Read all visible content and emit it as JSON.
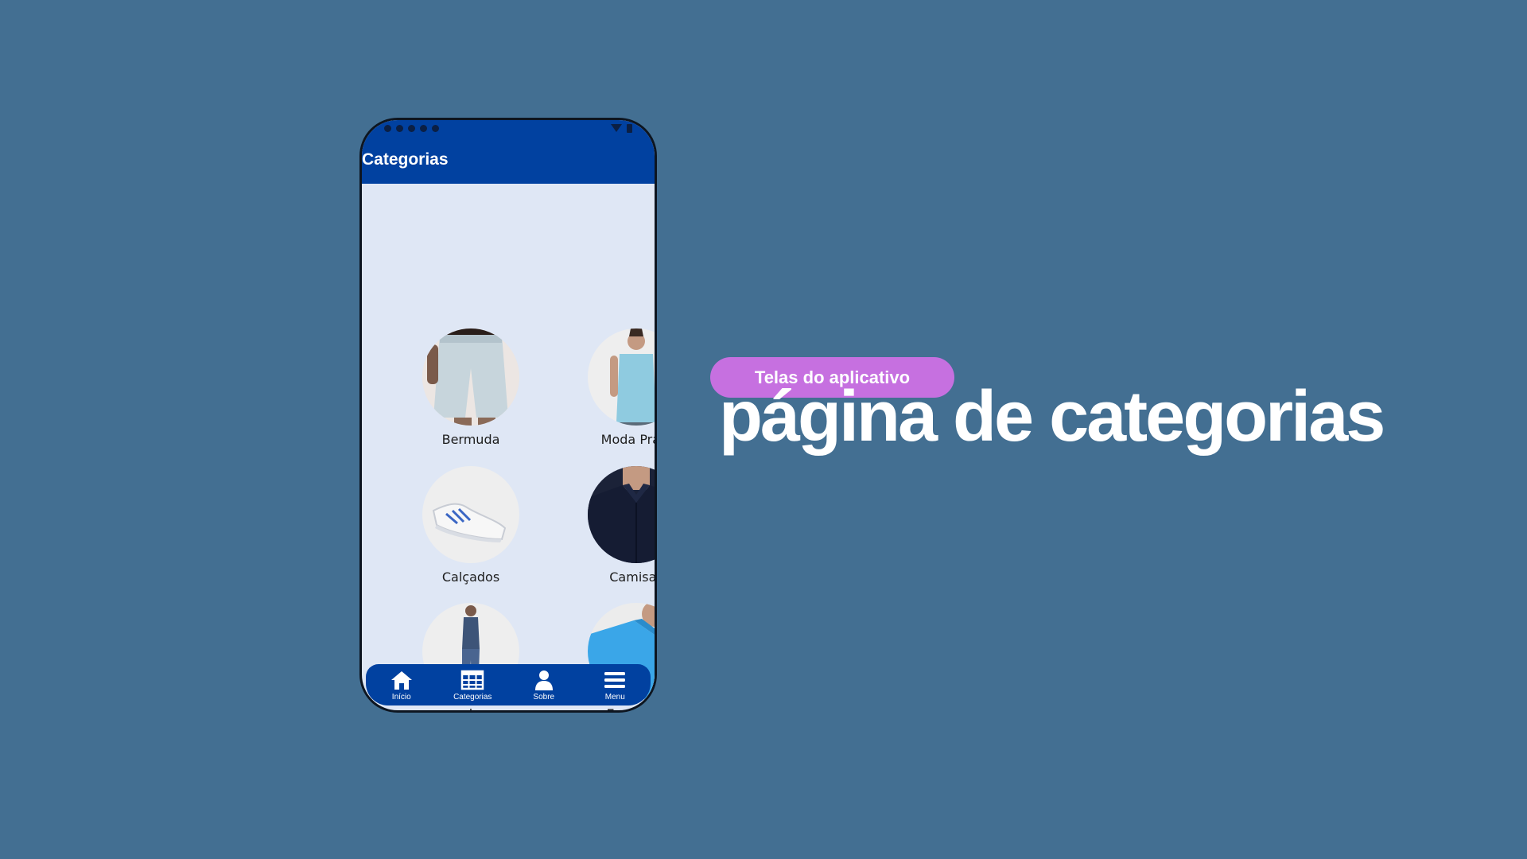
{
  "app": {
    "title": "Categorias"
  },
  "categories": [
    {
      "label": "Bermuda",
      "icon": "shorts-photo"
    },
    {
      "label": "Moda Praia",
      "icon": "tank-top-photo"
    },
    {
      "label": "Calçados",
      "icon": "sneaker-photo"
    },
    {
      "label": "Camisas",
      "icon": "shirt-photo"
    },
    {
      "label": "calça",
      "icon": "jeans-photo"
    },
    {
      "label": "Esportivo",
      "icon": "tshirt-photo"
    }
  ],
  "nav": [
    {
      "label": "Início",
      "icon": "home-icon"
    },
    {
      "label": "Categorias",
      "icon": "grid-icon"
    },
    {
      "label": "Sobre",
      "icon": "person-icon"
    },
    {
      "label": "Menu",
      "icon": "menu-icon"
    }
  ],
  "slide": {
    "pill": "Telas do aplicativo",
    "headline": "página de categorias"
  },
  "colors": {
    "background": "#436f92",
    "appbar": "#0141a0",
    "screen": "#dfe7f5",
    "pill": "#c670e0"
  }
}
